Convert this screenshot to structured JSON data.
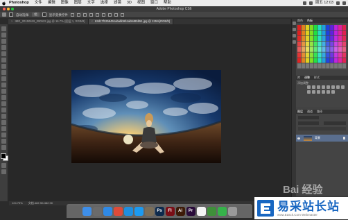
{
  "menubar": {
    "items": [
      "Photoshop",
      "文件",
      "编辑",
      "图像",
      "图层",
      "文字",
      "选择",
      "滤镜",
      "3D",
      "视图",
      "窗口",
      "帮助"
    ],
    "clock": "周五 12:03"
  },
  "window": {
    "title": "Adobe Photoshop CS6"
  },
  "options": {
    "auto_select": "自动选择:",
    "group": "组",
    "show_transform": "显示变换控件"
  },
  "tabs": [
    {
      "label": "IMG_20150619_090522.jpg @ 16.7% (图层 1, RGB/8)"
    },
    {
      "label": "63d17f1256451ababb9b1ab9485b51.jpg @ 125%(RGB/8)"
    }
  ],
  "panels": {
    "swatch_tabs": [
      "颜色",
      "色板"
    ],
    "lib_tabs": [
      "库",
      "调整",
      "样式"
    ],
    "adjust_title": "添加调整",
    "layer_tabs": [
      "图层",
      "通道",
      "路径"
    ],
    "layer_name": "背景"
  },
  "status": {
    "zoom": "124.79%",
    "doc": "文档:482.9K/482.9K"
  },
  "dock_icons": [
    {
      "name": "finder-icon",
      "color": "#3e8ee8",
      "glyph": ""
    },
    {
      "name": "launchpad-icon",
      "color": "#6b6b6b",
      "glyph": ""
    },
    {
      "name": "safari-icon",
      "color": "#2f89e5",
      "glyph": ""
    },
    {
      "name": "chrome-icon",
      "color": "#dd4b39",
      "glyph": ""
    },
    {
      "name": "qq-icon",
      "color": "#1f8fe0",
      "glyph": ""
    },
    {
      "name": "appstore-icon",
      "color": "#1c9af1",
      "glyph": ""
    },
    {
      "name": "preview-icon",
      "color": "#7b6f5a",
      "glyph": ""
    },
    {
      "name": "photoshop-icon",
      "color": "#0d2a4d",
      "glyph": "Ps"
    },
    {
      "name": "flash-icon",
      "color": "#7a0e16",
      "glyph": "Fl"
    },
    {
      "name": "illustrator-icon",
      "color": "#3d1b08",
      "glyph": "Ai"
    },
    {
      "name": "premiere-icon",
      "color": "#2a0c3a",
      "glyph": "Pr"
    },
    {
      "name": "calendar-icon",
      "color": "#f4f4f4",
      "glyph": ""
    },
    {
      "name": "evernote-icon",
      "color": "#3f8f3a",
      "glyph": ""
    },
    {
      "name": "wechat-icon",
      "color": "#36b24a",
      "glyph": ""
    },
    {
      "name": "trash-icon",
      "color": "#9a9a9a",
      "glyph": ""
    }
  ],
  "watermark": {
    "cn": "易采站长站",
    "en": "www.Easck.Com Webmaster",
    "baidu": "Bai 经验"
  },
  "colors": {
    "accent": "#1766c1",
    "panel": "#424242",
    "workspace": "#282828"
  }
}
